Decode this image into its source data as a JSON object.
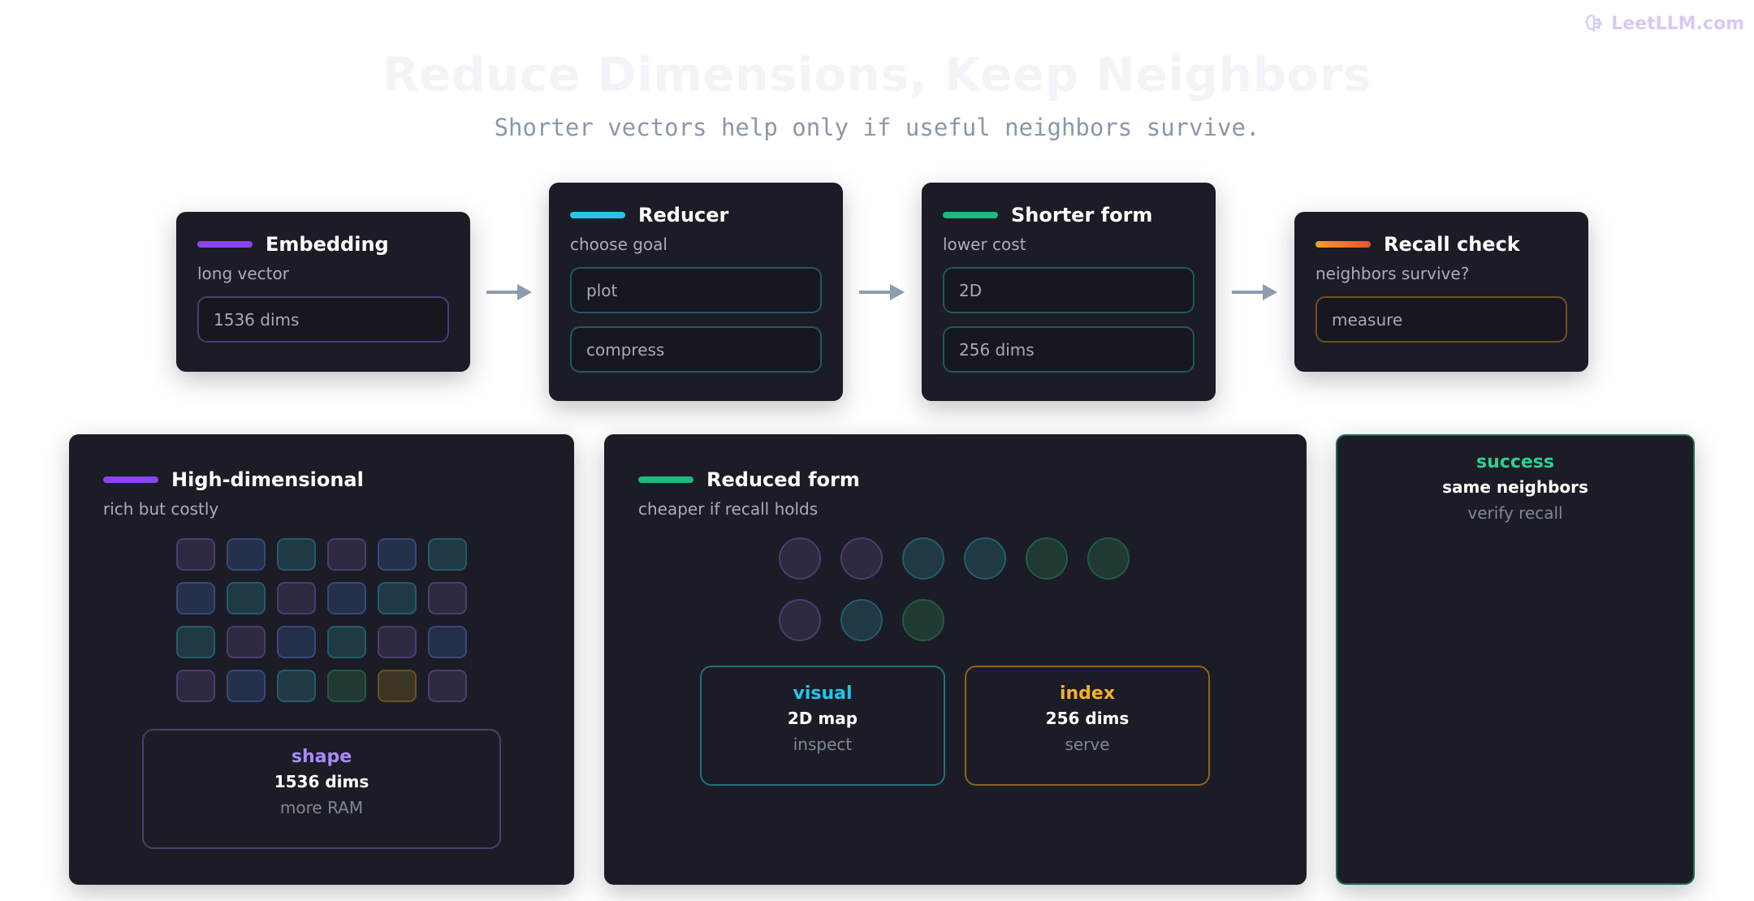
{
  "brand": {
    "name": "LeetLLM.com",
    "icon": "brain-icon"
  },
  "title": "Reduce Dimensions, Keep Neighbors",
  "subtitle": "Shorter vectors help only if useful neighbors survive.",
  "colors": {
    "purple": "#8b45f0",
    "cyan": "#22c7e6",
    "green": "#20b87d",
    "orange": "#f2792a",
    "amber": "#e5a11f",
    "arrow": "#8f9bb0",
    "card_bg": "#1c1c26"
  },
  "steps": [
    {
      "title": "Embedding",
      "sub": "long vector",
      "accent": "purple",
      "pills": [
        "1536 dims"
      ]
    },
    {
      "title": "Reducer",
      "sub": "choose goal",
      "accent": "cyan",
      "pills": [
        "plot",
        "compress"
      ]
    },
    {
      "title": "Shorter form",
      "sub": "lower cost",
      "accent": "green",
      "pills": [
        "2D",
        "256 dims"
      ]
    },
    {
      "title": "Recall check",
      "sub": "neighbors survive?",
      "accent": "orange",
      "pills": [
        "measure"
      ]
    }
  ],
  "high_dim": {
    "title": "High-dimensional",
    "sub": "rich but costly",
    "box": {
      "label": "shape",
      "value": "1536 dims",
      "note": "more RAM"
    }
  },
  "reduced": {
    "title": "Reduced form",
    "sub": "cheaper if recall holds",
    "boxes": [
      {
        "label": "visual",
        "value": "2D map",
        "note": "inspect"
      },
      {
        "label": "index",
        "value": "256 dims",
        "note": "serve"
      }
    ]
  },
  "result": {
    "label": "success",
    "value": "same neighbors",
    "note": "verify recall"
  }
}
